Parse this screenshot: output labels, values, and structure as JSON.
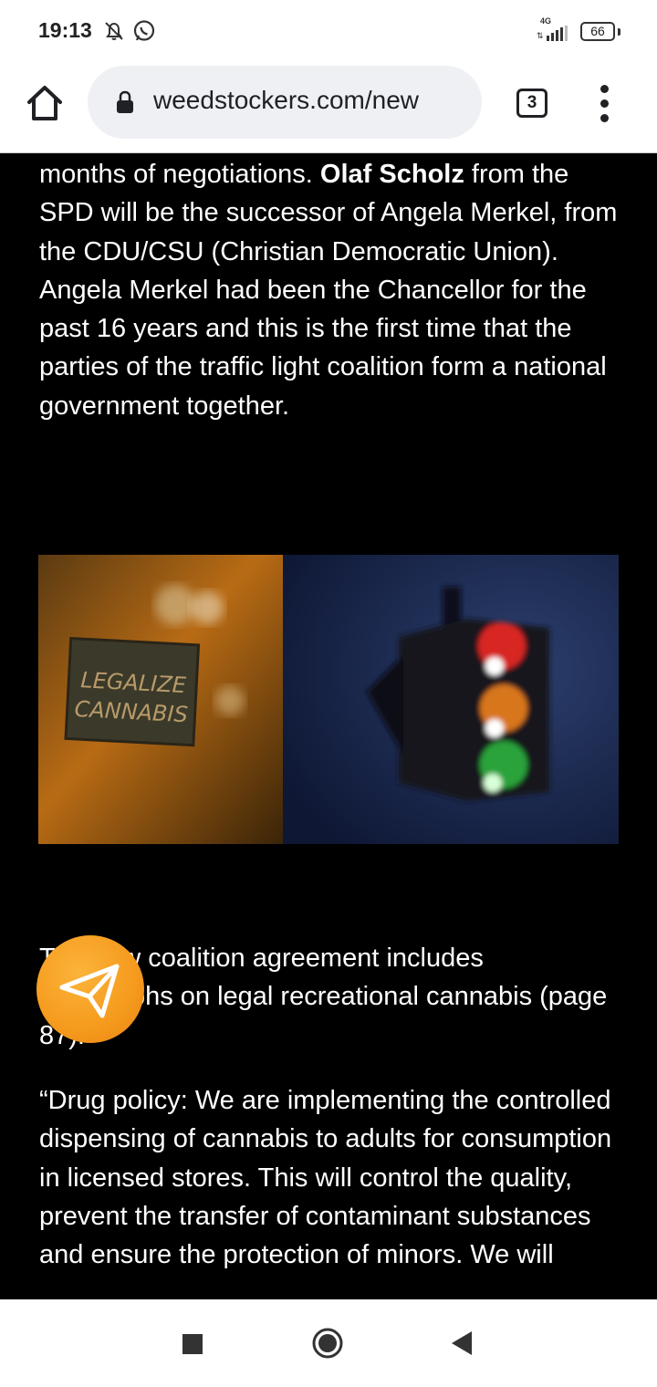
{
  "status_bar": {
    "time": "19:13",
    "network_type": "4G",
    "battery_level": "66",
    "icons": [
      "silent-bell-icon",
      "whatsapp-icon",
      "signal-icon",
      "battery-icon"
    ]
  },
  "browser": {
    "url": "weedstockers.com/new",
    "tab_count": "3",
    "icons": [
      "home-icon",
      "lock-icon",
      "tabs-icon",
      "more-vert-icon"
    ]
  },
  "article": {
    "para1": {
      "part1": "months of negotiations. ",
      "bold": "Olaf Scholz",
      "part2": " from the SPD will be the successor of Angela Merkel, from the CDU/CSU (Christian Democratic Union). Angela Merkel had been the Chancellor for the past 16 years and this is the first time that the parties of the traffic light coalition form a national government together."
    },
    "image": {
      "sign_line1": "LEGALIZE",
      "sign_line2": "CANNABIS"
    },
    "para2": "The new coalition agreement includes paragraphs on legal recreational cannabis (page 87):",
    "para3": "“Drug policy: We are implementing the controlled dispensing of cannabis to adults for consumption in licensed stores. This will control the quality, prevent the transfer of contaminant substances and ensure the protection of minors. We will"
  },
  "share_button": {
    "icon": "paper-plane-icon",
    "color": "#F59A1D"
  },
  "nav_bar": {
    "icons": [
      "recents-square-icon",
      "home-circle-icon",
      "back-triangle-icon"
    ]
  }
}
